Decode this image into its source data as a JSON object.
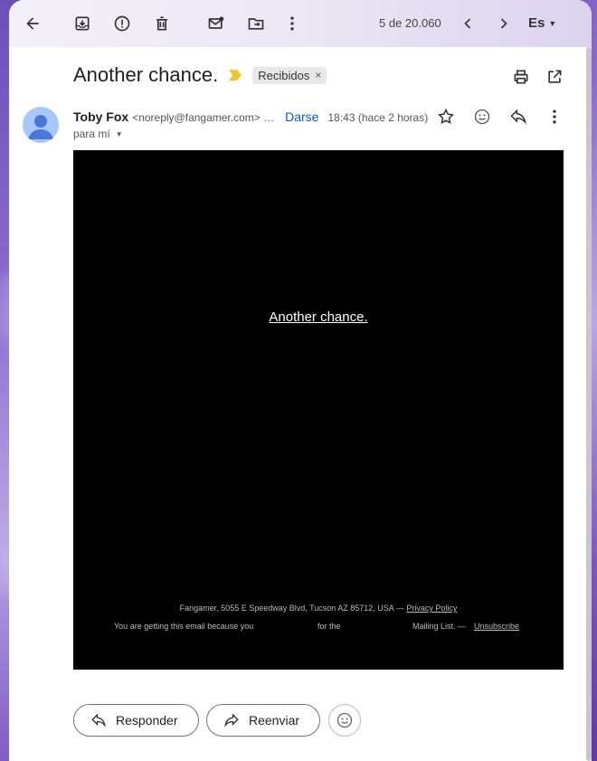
{
  "toolbar": {
    "counter": "5 de 20.060",
    "lang": "Es"
  },
  "message": {
    "subject": "Another chance.",
    "label": "Recibidos",
    "sender_name": "Toby Fox",
    "sender_email": "<noreply@fangamer.com> …",
    "unsubscribe": "Darse",
    "time": "18:43 (hace 2 horas)",
    "to": "para mí"
  },
  "body": {
    "title": "Another chance.",
    "footer_address": "Fangamer, 5055 E Speedway Blvd, Tucson AZ 85712, USA —",
    "privacy": "Privacy Policy",
    "footer_reason_a": "You are getting this email because you",
    "footer_reason_b": "for the",
    "footer_reason_c": "Mailing List. —",
    "unsubscribe": "Unsubscribe"
  },
  "actions": {
    "reply": "Responder",
    "forward": "Reenviar"
  },
  "colors": {
    "link_blue": "#0b57d0",
    "important_marker": "#f4c430",
    "avatar_bg": "#a8c7fa"
  }
}
